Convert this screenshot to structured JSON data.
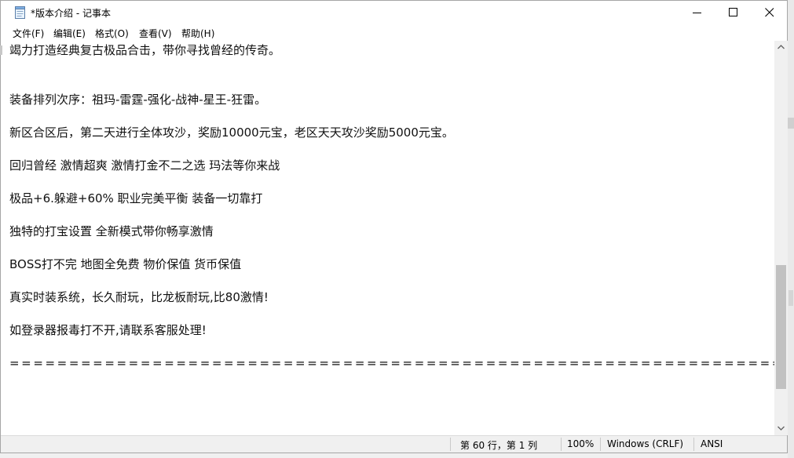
{
  "window": {
    "title": "*版本介绍 - 记事本"
  },
  "menu": {
    "file": "文件(F)",
    "edit": "编辑(E)",
    "format": "格式(O)",
    "view": "查看(V)",
    "help": "帮助(H)"
  },
  "document": {
    "lines": [
      "竭力打造经典复古极品合击，带你寻找曾经的传奇。",
      "",
      "装备排列次序：祖玛-雷霆-强化-战神-星王-狂雷。",
      "新区合区后，第二天进行全体攻沙，奖励10000元宝，老区天天攻沙奖励5000元宝。",
      "回归曾经 激情超爽 激情打金不二之选 玛法等你来战",
      "极品+6.躲避+60% 职业完美平衡 装备一切靠打",
      "独特的打宝设置 全新模式带你畅享激情",
      "BOSS打不完 地图全免费 物价保值 货币保值",
      "真实时装系统，长久耐玩，比龙板耐玩,比80激情!",
      "如登录器报毒打不开,请联系客服处理!",
      "==========================================================================="
    ]
  },
  "status": {
    "position": "第 60 行，第 1 列",
    "zoom": "100%",
    "line_ending": "Windows (CRLF)",
    "encoding": "ANSI"
  },
  "icons": {
    "app": "notepad-icon",
    "minimize": "minimize-icon",
    "maximize": "maximize-icon",
    "close": "close-icon"
  }
}
